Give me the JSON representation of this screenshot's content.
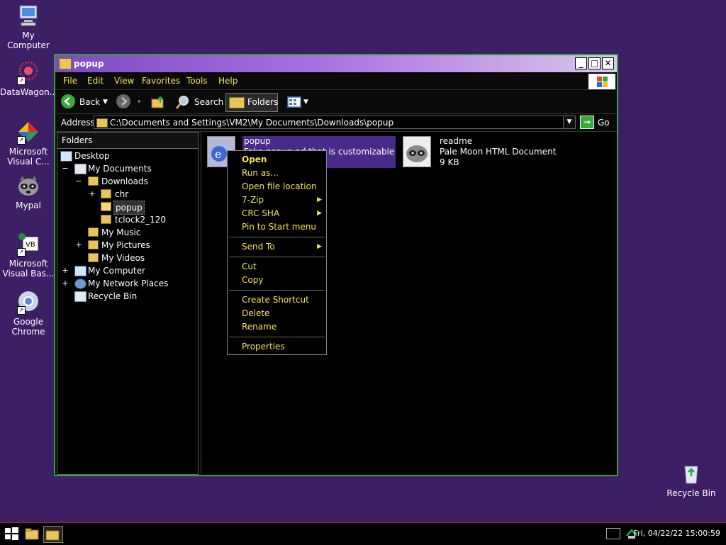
{
  "desktop": {
    "icons": [
      {
        "label": "My Computer"
      },
      {
        "label": "DataWagon..."
      },
      {
        "label": "Microsoft Visual C..."
      },
      {
        "label": "Mypal"
      },
      {
        "label": "Microsoft Visual Bas..."
      },
      {
        "label": "Google Chrome"
      },
      {
        "label": "Recycle Bin"
      }
    ]
  },
  "window": {
    "title": "popup",
    "menu": [
      "File",
      "Edit",
      "View",
      "Favorites",
      "Tools",
      "Help"
    ],
    "toolbar": {
      "back": "Back",
      "search": "Search",
      "folders": "Folders"
    },
    "address": {
      "label": "Address",
      "value": "C:\\Documents and Settings\\VM2\\My Documents\\Downloads\\popup",
      "go": "Go"
    },
    "folders_pane": {
      "header": "Folders",
      "tree": [
        {
          "label": "Desktop",
          "expander": ""
        },
        {
          "label": "My Documents",
          "expander": "−"
        },
        {
          "label": "Downloads",
          "expander": "−"
        },
        {
          "label": "chr",
          "expander": "+"
        },
        {
          "label": "popup",
          "expander": ""
        },
        {
          "label": "tclock2_120",
          "expander": ""
        },
        {
          "label": "My Music",
          "expander": ""
        },
        {
          "label": "My Pictures",
          "expander": "+"
        },
        {
          "label": "My Videos",
          "expander": ""
        },
        {
          "label": "My Computer",
          "expander": "+"
        },
        {
          "label": "My Network Places",
          "expander": "+"
        },
        {
          "label": "Recycle Bin",
          "expander": ""
        }
      ]
    },
    "files": [
      {
        "name": "popup",
        "line2": "Fake popup ad that is customizable",
        "line3": ""
      },
      {
        "name": "readme",
        "line2": "Pale Moon HTML Document",
        "line3": "9 KB"
      }
    ]
  },
  "context_menu": {
    "groups": [
      [
        {
          "label": "Open",
          "bold": true,
          "submenu": false
        },
        {
          "label": "Run as...",
          "submenu": false
        },
        {
          "label": "Open file location",
          "submenu": false
        },
        {
          "label": "7-Zip",
          "submenu": true
        },
        {
          "label": "CRC SHA",
          "submenu": true
        },
        {
          "label": "Pin to Start menu",
          "submenu": false
        }
      ],
      [
        {
          "label": "Send To",
          "submenu": true
        }
      ],
      [
        {
          "label": "Cut",
          "submenu": false
        },
        {
          "label": "Copy",
          "submenu": false
        }
      ],
      [
        {
          "label": "Create Shortcut",
          "submenu": false
        },
        {
          "label": "Delete",
          "submenu": false
        },
        {
          "label": "Rename",
          "submenu": false
        }
      ],
      [
        {
          "label": "Properties",
          "submenu": false
        }
      ]
    ]
  },
  "taskbar": {
    "clock": "Fri, 04/22/22 15:00:59"
  },
  "colors": {
    "desktop": "#3d1f66",
    "menu_text": "#f2e84b",
    "window_border": "#2fa82f",
    "taskbar_accent": "#b02020"
  }
}
